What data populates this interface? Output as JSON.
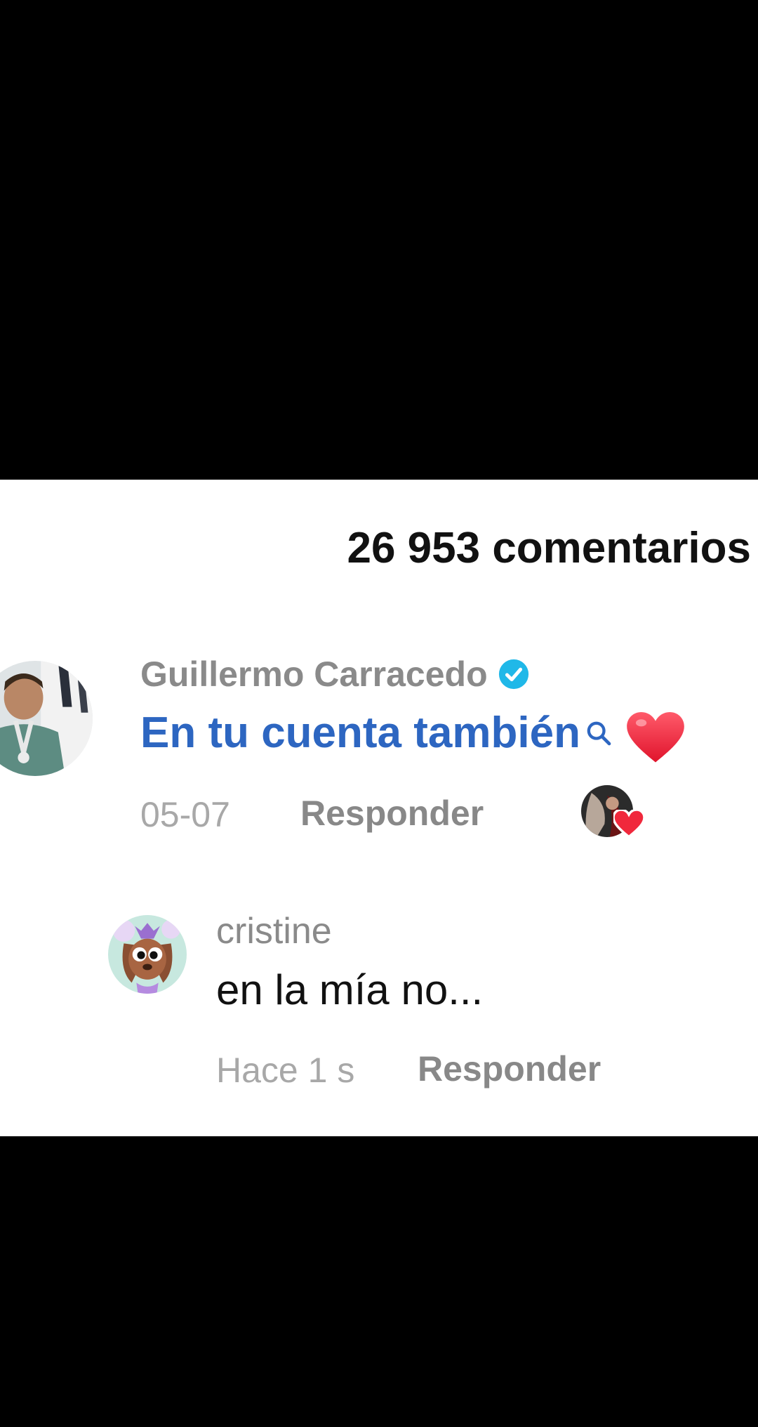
{
  "comments_header": {
    "count_label": "26 953 comentarios"
  },
  "main_comment": {
    "username": "Guillermo Carracedo",
    "verified": true,
    "text": "En tu cuenta también",
    "date": "05-07",
    "reply_label": "Responder",
    "liked_by_creator": true
  },
  "reply_comment": {
    "username": "cristine",
    "text": "en la mía no...",
    "date": "Hace 1 s",
    "reply_label": "Responder"
  },
  "colors": {
    "link_blue": "#2d66c1",
    "verified_blue": "#20b8e8",
    "heart_red": "#f0283c",
    "muted_gray": "#8a8a8a"
  },
  "icons": {
    "verified": "verified-badge-icon",
    "search": "search-icon",
    "heart": "heart-emoji-icon",
    "like": "heart-icon"
  }
}
